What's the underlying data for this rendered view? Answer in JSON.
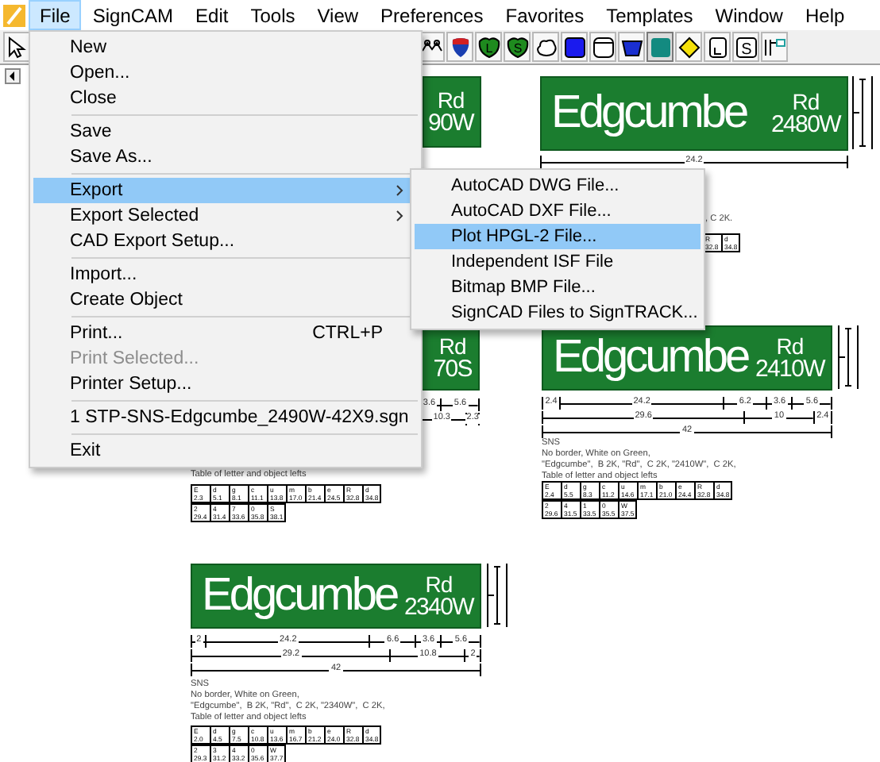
{
  "menu_bar": {
    "items": [
      {
        "label": "File",
        "selected": true
      },
      {
        "label": "SignCAM",
        "selected": false
      },
      {
        "label": "Edit",
        "selected": false
      },
      {
        "label": "Tools",
        "selected": false
      },
      {
        "label": "View",
        "selected": false
      },
      {
        "label": "Preferences",
        "selected": false
      },
      {
        "label": "Favorites",
        "selected": false
      },
      {
        "label": "Templates",
        "selected": false
      },
      {
        "label": "Window",
        "selected": false
      },
      {
        "label": "Help",
        "selected": false
      }
    ]
  },
  "toolbar": {
    "tools": [
      {
        "kind": "pointer",
        "selected": false
      },
      {
        "kind": "chain",
        "selected": false
      },
      {
        "kind": "interstate",
        "selected": false
      },
      {
        "kind": "shield",
        "letter": "L",
        "selected": false
      },
      {
        "kind": "shield",
        "letter": "S",
        "selected": false
      },
      {
        "kind": "cloud",
        "selected": false
      },
      {
        "kind": "square",
        "selected": false
      },
      {
        "kind": "rounded",
        "selected": false
      },
      {
        "kind": "bucket",
        "selected": false
      },
      {
        "kind": "square-teal",
        "selected": true
      },
      {
        "kind": "diamond",
        "selected": false
      },
      {
        "kind": "tab",
        "selected": false
      },
      {
        "kind": "letterbox",
        "letter": "S",
        "selected": false
      },
      {
        "kind": "bracket",
        "selected": false
      }
    ]
  },
  "file_menu": {
    "items": [
      {
        "kind": "item",
        "label": "New",
        "highlighted": false,
        "disabled": false
      },
      {
        "kind": "item",
        "label": "Open...",
        "highlighted": false,
        "disabled": false
      },
      {
        "kind": "item",
        "label": "Close",
        "highlighted": false,
        "disabled": false
      },
      {
        "kind": "separator"
      },
      {
        "kind": "item",
        "label": "Save",
        "highlighted": false,
        "disabled": false
      },
      {
        "kind": "item",
        "label": "Save As...",
        "highlighted": false,
        "disabled": false
      },
      {
        "kind": "separator"
      },
      {
        "kind": "submenu",
        "label": "Export",
        "highlighted": true,
        "disabled": false
      },
      {
        "kind": "submenu",
        "label": "Export Selected",
        "highlighted": false,
        "disabled": false
      },
      {
        "kind": "item",
        "label": "CAD Export Setup...",
        "highlighted": false,
        "disabled": false
      },
      {
        "kind": "separator"
      },
      {
        "kind": "item",
        "label": "Import...",
        "highlighted": false,
        "disabled": false
      },
      {
        "kind": "item",
        "label": "Create Object",
        "highlighted": false,
        "disabled": false
      },
      {
        "kind": "separator"
      },
      {
        "kind": "item",
        "label": "Print...",
        "shortcut": "CTRL+P",
        "highlighted": false,
        "disabled": false
      },
      {
        "kind": "item",
        "label": "Print Selected...",
        "highlighted": false,
        "disabled": true
      },
      {
        "kind": "item",
        "label": "Printer Setup...",
        "highlighted": false,
        "disabled": false
      },
      {
        "kind": "separator"
      },
      {
        "kind": "item",
        "label": "1 STP-SNS-Edgcumbe_2490W-42X9.sgn",
        "highlighted": false,
        "disabled": false
      },
      {
        "kind": "separator"
      },
      {
        "kind": "item",
        "label": "Exit",
        "highlighted": false,
        "disabled": false
      }
    ]
  },
  "export_submenu": {
    "items": [
      {
        "label": "AutoCAD DWG File...",
        "highlighted": false
      },
      {
        "label": "AutoCAD DXF File...",
        "highlighted": false
      },
      {
        "label": "Plot HPGL-2 File...",
        "highlighted": true
      },
      {
        "label": "Independent ISF File",
        "highlighted": false
      },
      {
        "label": "Bitmap BMP File...",
        "highlighted": false
      },
      {
        "label": "SignCAD Files to SignTRACK...",
        "highlighted": false
      }
    ]
  },
  "signs": [
    {
      "suffix": "Rd",
      "number": "90W"
    },
    {
      "name": "Edgcumbe",
      "suffix": "Rd",
      "number": "2480W",
      "dimension_rows": [
        [
          "24.2"
        ]
      ],
      "notes": [
        ", C 2K."
      ],
      "table_rows": [
        [
          {
            "letter": "R",
            "value": "32.8"
          },
          {
            "letter": "d",
            "value": "34.8"
          }
        ]
      ]
    },
    {
      "suffix": "Rd",
      "number": "70S",
      "dimension_rows": [
        [
          "3.6",
          "5.6"
        ],
        [
          "10.3",
          "2.3"
        ]
      ],
      "notes": [
        "Table of letter and object lefts"
      ],
      "table_rows": [
        [
          {
            "letter": "E",
            "value": "2.3"
          },
          {
            "letter": "d",
            "value": "5.1"
          },
          {
            "letter": "g",
            "value": "8.1"
          },
          {
            "letter": "c",
            "value": "11.1"
          },
          {
            "letter": "u",
            "value": "13.8"
          },
          {
            "letter": "m",
            "value": "17.0"
          },
          {
            "letter": "b",
            "value": "21.4"
          },
          {
            "letter": "e",
            "value": "24.5"
          },
          {
            "letter": "R",
            "value": "32.8"
          },
          {
            "letter": "d",
            "value": "34.8"
          }
        ],
        [
          {
            "letter": "2",
            "value": "29.4"
          },
          {
            "letter": "4",
            "value": "31.4"
          },
          {
            "letter": "7",
            "value": "33.6"
          },
          {
            "letter": "0",
            "value": "35.8"
          },
          {
            "letter": "S",
            "value": "38.1"
          }
        ]
      ]
    },
    {
      "name": "Edgcumbe",
      "suffix": "Rd",
      "number": "2410W",
      "dimension_rows": [
        [
          "2.4",
          "24.2",
          "6.2",
          "3.6",
          "5.6"
        ],
        [
          "29.6",
          "10",
          "2.4"
        ],
        [
          "42"
        ]
      ],
      "notes": [
        "SNS",
        "No border, White on Green,",
        "\"Edgcumbe\",  B 2K, \"Rd\",  C 2K, \"2410W\",  C 2K,",
        "Table of letter and object lefts"
      ],
      "table_rows": [
        [
          {
            "letter": "E",
            "value": "2.4"
          },
          {
            "letter": "d",
            "value": "5.5"
          },
          {
            "letter": "g",
            "value": "8.3"
          },
          {
            "letter": "c",
            "value": "11.2"
          },
          {
            "letter": "u",
            "value": "14.6"
          },
          {
            "letter": "m",
            "value": "17.1"
          },
          {
            "letter": "b",
            "value": "21.0"
          },
          {
            "letter": "e",
            "value": "24.4"
          },
          {
            "letter": "R",
            "value": "32.8"
          },
          {
            "letter": "d",
            "value": "34.8"
          }
        ],
        [
          {
            "letter": "2",
            "value": "29.6"
          },
          {
            "letter": "4",
            "value": "31.5"
          },
          {
            "letter": "1",
            "value": "33.5"
          },
          {
            "letter": "0",
            "value": "35.5"
          },
          {
            "letter": "W",
            "value": "37.5"
          }
        ]
      ]
    },
    {
      "name": "Edgcumbe",
      "suffix": "Rd",
      "number": "2340W",
      "dimension_rows": [
        [
          "2",
          "24.2",
          "6.6",
          "3.6",
          "5.6"
        ],
        [
          "29.2",
          "10.8",
          "2"
        ],
        [
          "42"
        ]
      ],
      "notes": [
        "SNS",
        "No border, White on Green,",
        "\"Edgcumbe\",  B 2K, \"Rd\",  C 2K, \"2340W\",  C 2K,",
        "Table of letter and object lefts"
      ],
      "table_rows": [
        [
          {
            "letter": "E",
            "value": "2.0"
          },
          {
            "letter": "d",
            "value": "4.5"
          },
          {
            "letter": "g",
            "value": "7.5"
          },
          {
            "letter": "c",
            "value": "10.8"
          },
          {
            "letter": "u",
            "value": "13.6"
          },
          {
            "letter": "m",
            "value": "16.7"
          },
          {
            "letter": "b",
            "value": "21.2"
          },
          {
            "letter": "e",
            "value": "24.0"
          },
          {
            "letter": "R",
            "value": "32.8"
          },
          {
            "letter": "d",
            "value": "34.8"
          }
        ],
        [
          {
            "letter": "2",
            "value": "29.3"
          },
          {
            "letter": "3",
            "value": "31.2"
          },
          {
            "letter": "4",
            "value": "33.2"
          },
          {
            "letter": "0",
            "value": "35.6"
          },
          {
            "letter": "W",
            "value": "37.7"
          }
        ]
      ]
    }
  ]
}
